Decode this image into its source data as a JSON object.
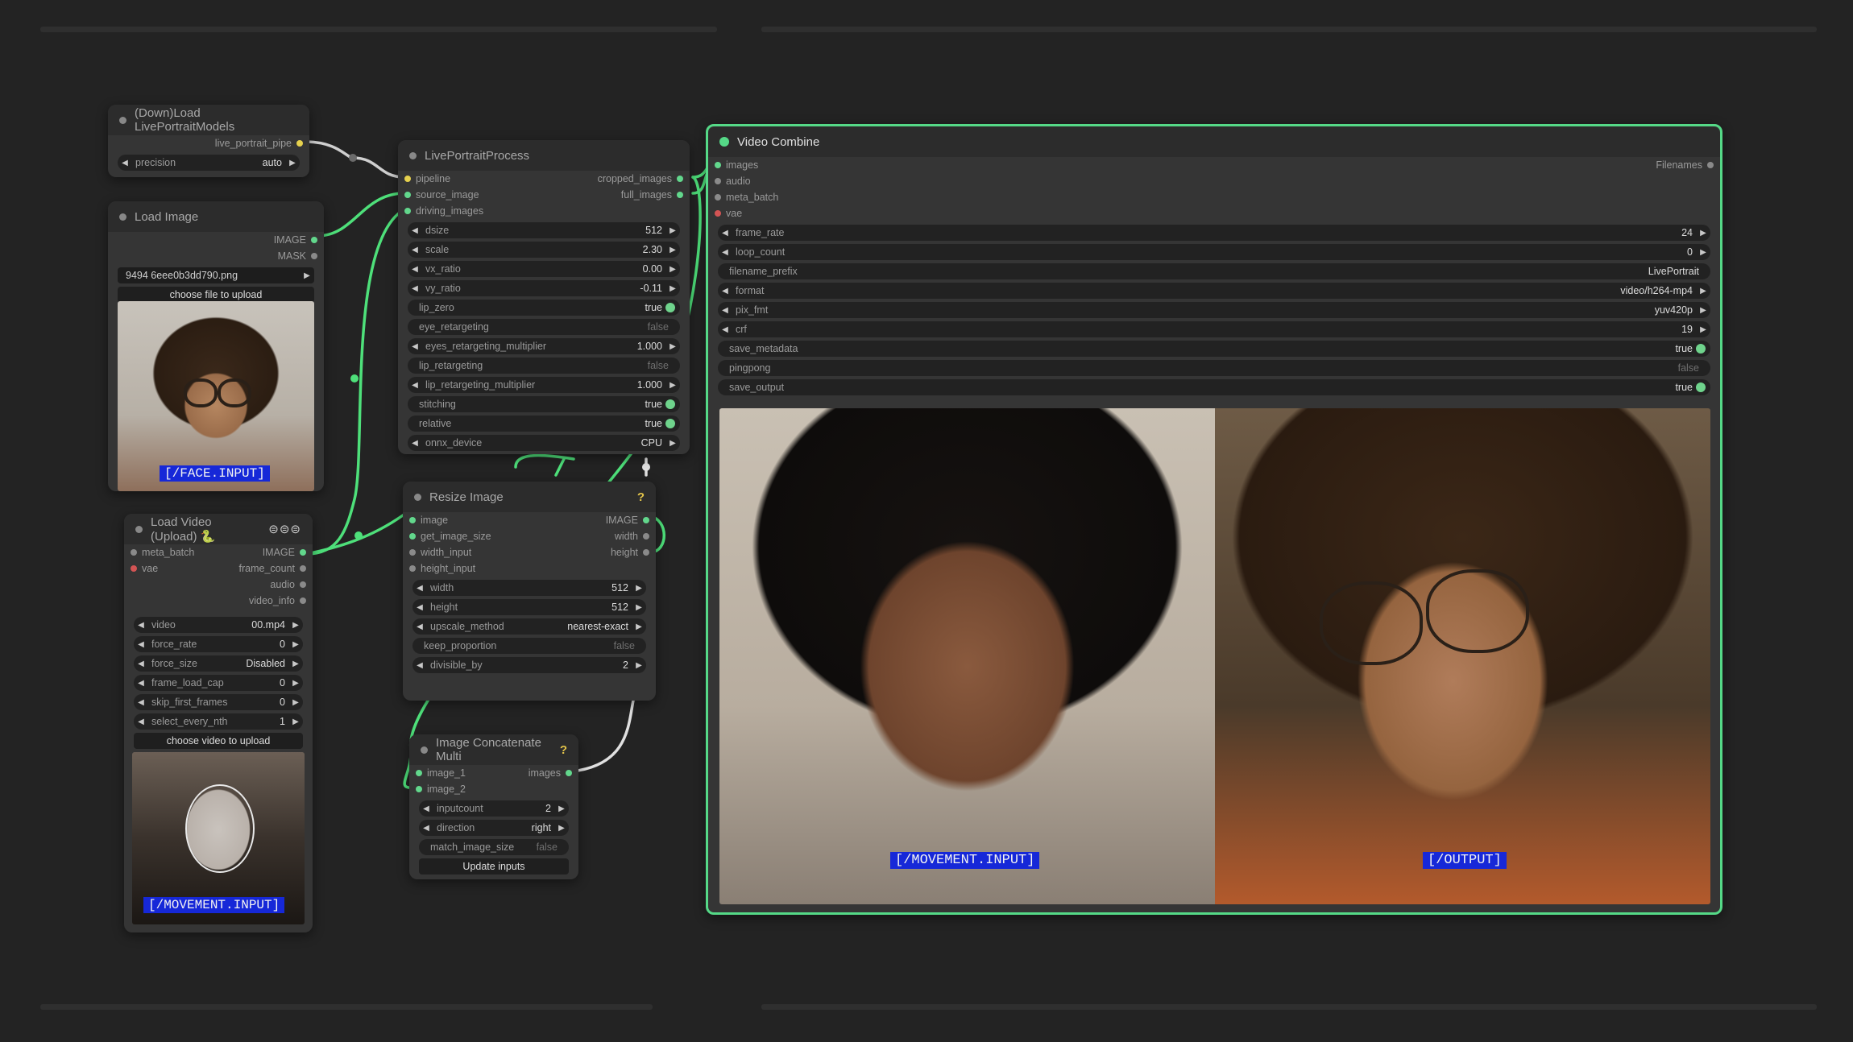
{
  "colors": {
    "wire": "#4ee07a",
    "accent": "#5ad68a",
    "tag_bg": "#1628d8",
    "canvas": "#232323"
  },
  "load_models": {
    "title": "(Down)Load LivePortraitModels",
    "out_live_portrait_pipe": "live_portrait_pipe",
    "precision": {
      "name": "precision",
      "value": "auto"
    }
  },
  "load_image": {
    "title": "Load Image",
    "out_image": "IMAGE",
    "out_mask": "MASK",
    "file": "9494 6eee0b3dd790.png",
    "upload_button": "choose file to upload",
    "tag": "[/FACE.INPUT]"
  },
  "load_video": {
    "title": "Load Video (Upload) 🐍",
    "icons": "⊜⊜⊜",
    "in_meta_batch": "meta_batch",
    "in_vae": "vae",
    "out_image": "IMAGE",
    "out_frame_count": "frame_count",
    "out_audio": "audio",
    "out_video_info": "video_info",
    "widgets": [
      {
        "name": "video",
        "value": "00.mp4"
      },
      {
        "name": "force_rate",
        "value": "0"
      },
      {
        "name": "force_size",
        "value": "Disabled"
      },
      {
        "name": "frame_load_cap",
        "value": "0"
      },
      {
        "name": "skip_first_frames",
        "value": "0"
      },
      {
        "name": "select_every_nth",
        "value": "1"
      }
    ],
    "upload_button": "choose video to upload",
    "tag": "[/MOVEMENT.INPUT]"
  },
  "live_portrait": {
    "title": "LivePortraitProcess",
    "in_pipeline": "pipeline",
    "in_source_image": "source_image",
    "in_driving_images": "driving_images",
    "out_cropped_images": "cropped_images",
    "out_full_images": "full_images",
    "widgets": [
      {
        "name": "dsize",
        "value": "512",
        "kind": "num"
      },
      {
        "name": "scale",
        "value": "2.30",
        "kind": "num"
      },
      {
        "name": "vx_ratio",
        "value": "0.00",
        "kind": "num"
      },
      {
        "name": "vy_ratio",
        "value": "-0.11",
        "kind": "num"
      },
      {
        "name": "lip_zero",
        "value": "true",
        "kind": "on"
      },
      {
        "name": "eye_retargeting",
        "value": "false",
        "kind": "off"
      },
      {
        "name": "eyes_retargeting_multiplier",
        "value": "1.000",
        "kind": "num"
      },
      {
        "name": "lip_retargeting",
        "value": "false",
        "kind": "off"
      },
      {
        "name": "lip_retargeting_multiplier",
        "value": "1.000",
        "kind": "num"
      },
      {
        "name": "stitching",
        "value": "true",
        "kind": "on"
      },
      {
        "name": "relative",
        "value": "true",
        "kind": "on"
      },
      {
        "name": "onnx_device",
        "value": "CPU",
        "kind": "num"
      }
    ]
  },
  "resize_image": {
    "title": "Resize Image",
    "help": "?",
    "in_image": "image",
    "in_get_image_size": "get_image_size",
    "in_width_input": "width_input",
    "in_height_input": "height_input",
    "out_image": "IMAGE",
    "out_width": "width",
    "out_height": "height",
    "widgets": [
      {
        "name": "width",
        "value": "512",
        "kind": "num"
      },
      {
        "name": "height",
        "value": "512",
        "kind": "num"
      },
      {
        "name": "upscale_method",
        "value": "nearest-exact",
        "kind": "num"
      },
      {
        "name": "keep_proportion",
        "value": "false",
        "kind": "off"
      },
      {
        "name": "divisible_by",
        "value": "2",
        "kind": "num"
      }
    ]
  },
  "concat": {
    "title": "Image Concatenate Multi",
    "help": "?",
    "in_image_1": "image_1",
    "in_image_2": "image_2",
    "out_images": "images",
    "widgets": [
      {
        "name": "inputcount",
        "value": "2",
        "kind": "num"
      },
      {
        "name": "direction",
        "value": "right",
        "kind": "num"
      },
      {
        "name": "match_image_size",
        "value": "false",
        "kind": "off"
      }
    ],
    "update_button": "Update inputs"
  },
  "video_combine": {
    "title": "Video Combine",
    "in_images": "images",
    "in_audio": "audio",
    "in_meta_batch": "meta_batch",
    "in_vae": "vae",
    "out_filenames": "Filenames",
    "widgets": [
      {
        "name": "frame_rate",
        "value": "24",
        "kind": "num"
      },
      {
        "name": "loop_count",
        "value": "0",
        "kind": "num"
      },
      {
        "name": "filename_prefix",
        "value": "LivePortrait",
        "kind": "text"
      },
      {
        "name": "format",
        "value": "video/h264-mp4",
        "kind": "num"
      },
      {
        "name": "pix_fmt",
        "value": "yuv420p",
        "kind": "num"
      },
      {
        "name": "crf",
        "value": "19",
        "kind": "num"
      },
      {
        "name": "save_metadata",
        "value": "true",
        "kind": "on"
      },
      {
        "name": "pingpong",
        "value": "false",
        "kind": "off"
      },
      {
        "name": "save_output",
        "value": "true",
        "kind": "on"
      }
    ],
    "tag_left": "[/MOVEMENT.INPUT]",
    "tag_right": "[/OUTPUT]"
  }
}
